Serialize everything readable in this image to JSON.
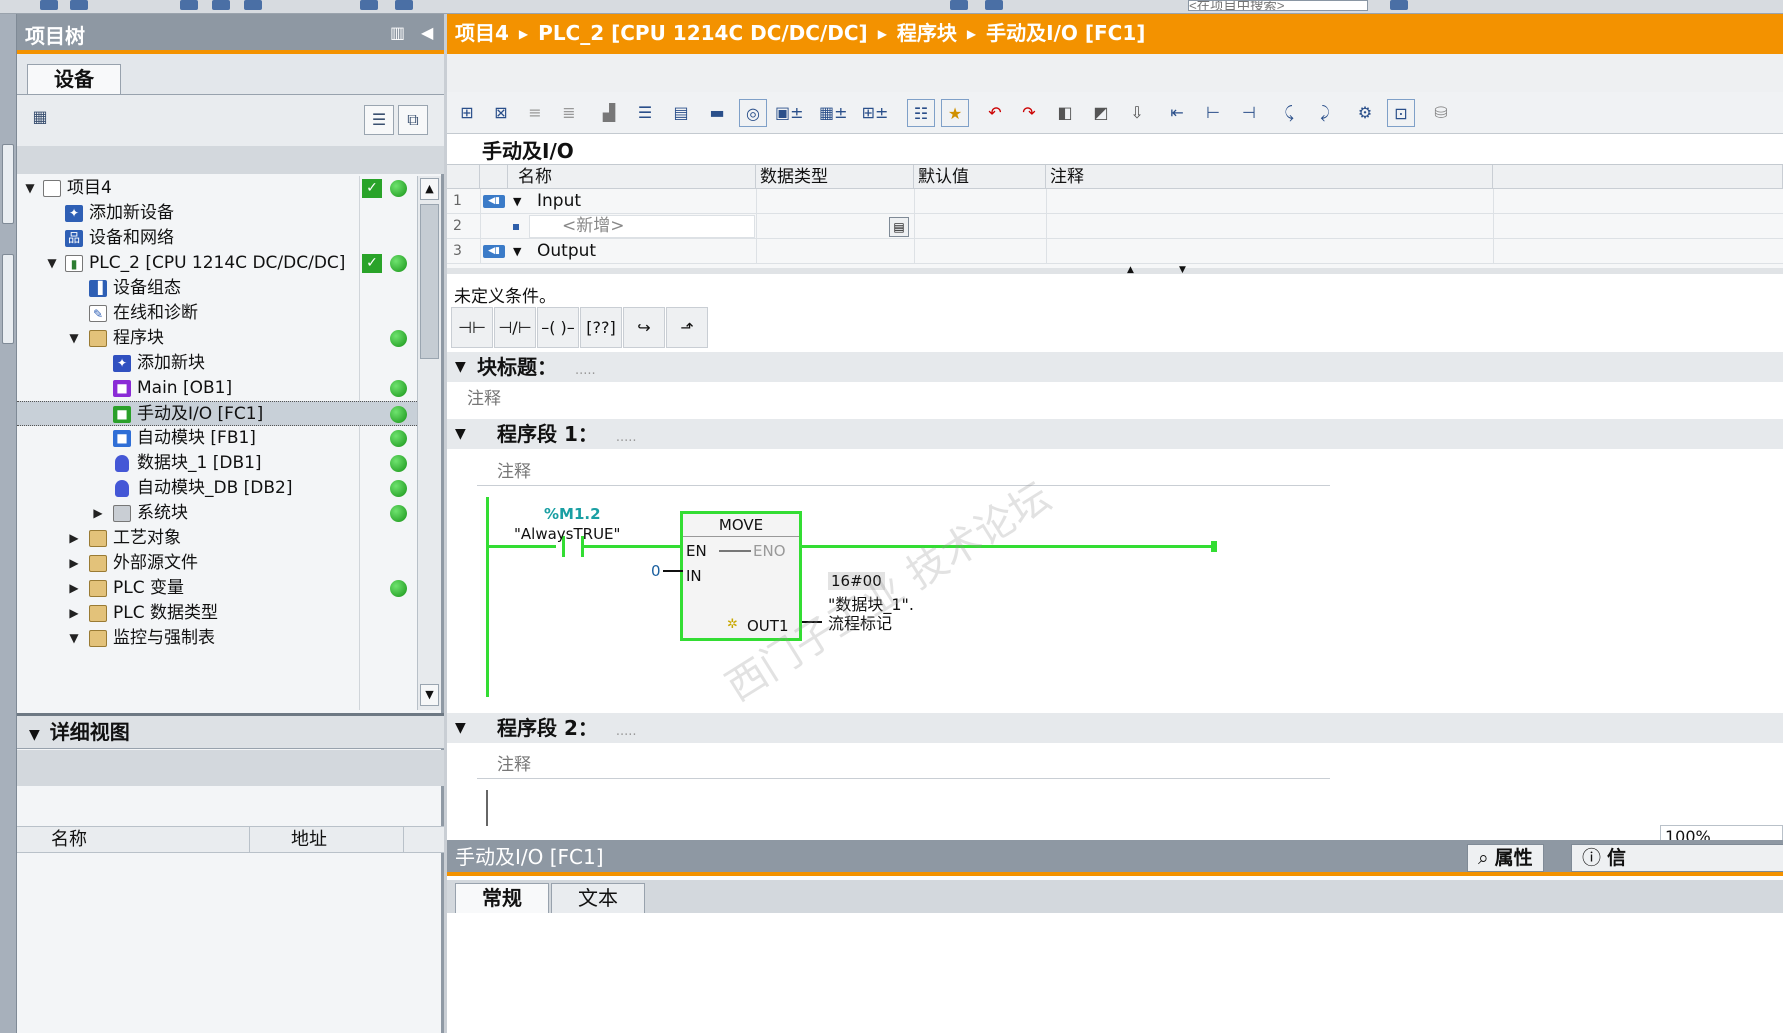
{
  "top_search": {
    "placeholder": "<在项目中搜索>"
  },
  "tree": {
    "title": "项目树",
    "tab_device": "设备",
    "items": [
      {
        "label": "项目4",
        "check": true,
        "status": "green"
      },
      {
        "label": "添加新设备"
      },
      {
        "label": "设备和网络"
      },
      {
        "label": "PLC_2 [CPU 1214C DC/DC/DC]",
        "check": true,
        "status": "green"
      },
      {
        "label": "设备组态"
      },
      {
        "label": "在线和诊断"
      },
      {
        "label": "程序块",
        "status": "green"
      },
      {
        "label": "添加新块"
      },
      {
        "label": "Main [OB1]",
        "status": "green"
      },
      {
        "label": "手动及I/O [FC1]",
        "status": "green",
        "selected": true
      },
      {
        "label": "自动模块 [FB1]",
        "status": "green"
      },
      {
        "label": "数据块_1 [DB1]",
        "status": "green"
      },
      {
        "label": "自动模块_DB [DB2]",
        "status": "green"
      },
      {
        "label": "系统块",
        "status": "green"
      },
      {
        "label": "工艺对象"
      },
      {
        "label": "外部源文件"
      },
      {
        "label": "PLC 变量",
        "status": "green"
      },
      {
        "label": "PLC 数据类型"
      },
      {
        "label": "监控与强制表"
      }
    ]
  },
  "detail": {
    "title": "详细视图",
    "col_name": "名称",
    "col_addr": "地址"
  },
  "editor": {
    "breadcrumb": [
      "项目4",
      "PLC_2 [CPU 1214C DC/DC/DC]",
      "程序块",
      "手动及I/O [FC1]"
    ],
    "block_name": "手动及I/O",
    "interface": {
      "headers": [
        "名称",
        "数据类型",
        "默认值",
        "注释"
      ],
      "rows": [
        {
          "num": "1",
          "name": "Input"
        },
        {
          "num": "2",
          "name": "<新增>"
        },
        {
          "num": "3",
          "name": "Output"
        }
      ]
    },
    "condition_text": "未定义条件。",
    "block_title_label": "块标题：",
    "block_title_dots": ".....",
    "comment_placeholder": "注释",
    "network1": {
      "title": "程序段 1：",
      "dots": ".....",
      "contact_address": "%M1.2",
      "contact_name": "\"AlwaysTRUE\"",
      "move_title": "MOVE",
      "pin_en": "EN",
      "pin_eno": "ENO",
      "pin_in": "IN",
      "pin_out": "OUT1",
      "in_value": "0",
      "out_value": "16#00",
      "out_tag_line1": "\"数据块_1\".",
      "out_tag_line2": "流程标记"
    },
    "network2": {
      "title": "程序段 2：",
      "dots": "....."
    },
    "zoom": "100%"
  },
  "inspector": {
    "title": "手动及I/O [FC1]",
    "properties_btn": "属性",
    "info_btn": "信",
    "tab_general": "常规",
    "tab_text": "文本"
  },
  "colors": {
    "accent": "#f39200",
    "rung": "#33dd33",
    "status_ok": "#179317"
  }
}
